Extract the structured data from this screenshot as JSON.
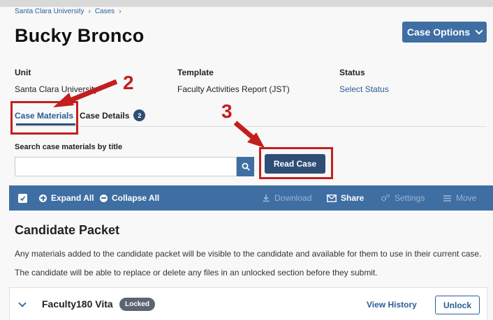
{
  "breadcrumb": {
    "items": [
      "Santa Clara University",
      "Cases"
    ],
    "sep": "›"
  },
  "page_title": "Bucky Bronco",
  "case_options_label": "Case Options",
  "meta": {
    "unit": {
      "label": "Unit",
      "value": "Santa Clara University"
    },
    "template": {
      "label": "Template",
      "value": "Faculty Activities Report (JST)"
    },
    "status": {
      "label": "Status",
      "value": "Select Status"
    }
  },
  "tabs": [
    {
      "label": "Case Materials",
      "active": true
    },
    {
      "label": "Case Details",
      "badge": "2",
      "active": false
    }
  ],
  "search": {
    "label": "Search case materials by title",
    "value": "",
    "placeholder": ""
  },
  "read_case_label": "Read Case",
  "toolbar": {
    "expand_all": "Expand All",
    "collapse_all": "Collapse All",
    "download": "Download",
    "share": "Share",
    "settings": "Settings",
    "move": "Move"
  },
  "section": {
    "title": "Candidate Packet",
    "description": "Any materials added to the candidate packet will be visible to the candidate and available for them to use in their current case. The candidate will be able to replace or delete any files in an unlocked section before they submit."
  },
  "item": {
    "title": "Faculty180 Vita",
    "badge": "Locked",
    "view_history": "View History",
    "unlock": "Unlock"
  },
  "annotations": {
    "step2": "2",
    "step3": "3"
  },
  "colors": {
    "primary": "#3f6ea3",
    "dark": "#2f4e76",
    "link": "#2a5d94",
    "callout": "#c41e1e"
  },
  "icons": [
    "chevron-down-icon",
    "search-icon",
    "checkbox-icon",
    "plus-circle-icon",
    "minus-circle-icon",
    "download-icon",
    "envelope-icon",
    "gear-icon",
    "list-icon"
  ]
}
